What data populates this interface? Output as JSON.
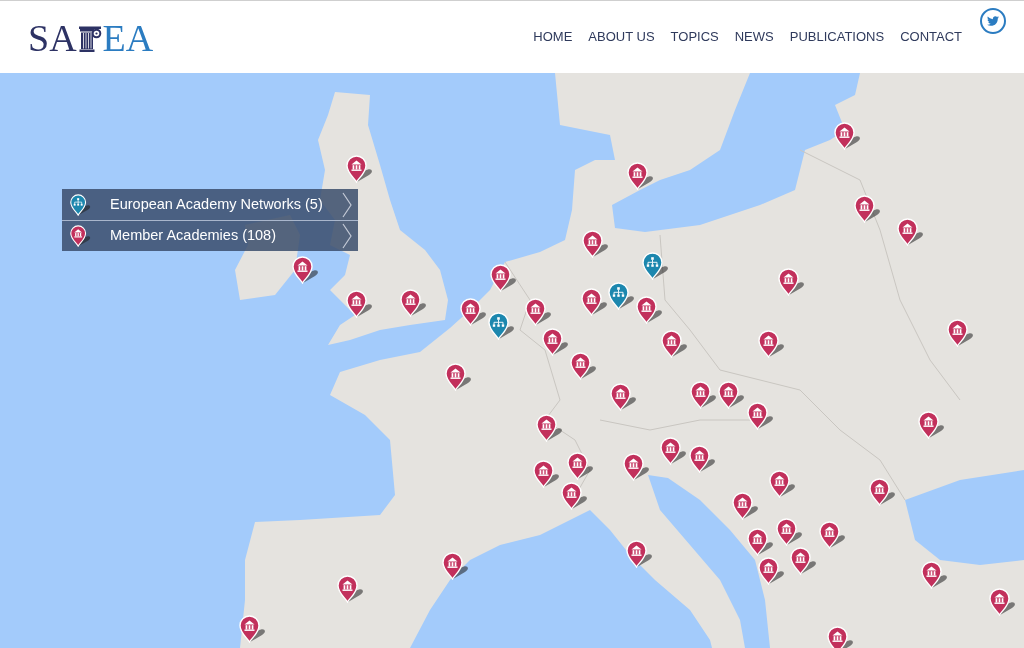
{
  "header": {
    "logo": {
      "text_before": "SA",
      "text_after": "EA"
    },
    "nav": [
      "HOME",
      "ABOUT US",
      "TOPICS",
      "NEWS",
      "PUBLICATIONS",
      "CONTACT"
    ]
  },
  "map": {
    "legend": [
      {
        "kind": "network",
        "label": "European Academy Networks (5)"
      },
      {
        "kind": "academy",
        "label": "Member Academies (108)"
      }
    ],
    "markers": [
      {
        "kind": "academy"
      },
      {
        "kind": "academy"
      },
      {
        "kind": "academy"
      },
      {
        "kind": "academy"
      },
      {
        "kind": "academy"
      },
      {
        "kind": "academy"
      },
      {
        "kind": "academy"
      },
      {
        "kind": "network"
      },
      {
        "kind": "academy"
      },
      {
        "kind": "academy"
      },
      {
        "kind": "academy"
      },
      {
        "kind": "academy"
      },
      {
        "kind": "network"
      },
      {
        "kind": "academy"
      },
      {
        "kind": "network"
      },
      {
        "kind": "academy"
      },
      {
        "kind": "academy"
      },
      {
        "kind": "academy"
      },
      {
        "kind": "academy"
      },
      {
        "kind": "academy"
      },
      {
        "kind": "academy"
      },
      {
        "kind": "academy"
      },
      {
        "kind": "academy"
      },
      {
        "kind": "academy"
      },
      {
        "kind": "academy"
      },
      {
        "kind": "academy"
      },
      {
        "kind": "academy"
      },
      {
        "kind": "academy"
      },
      {
        "kind": "academy"
      },
      {
        "kind": "academy"
      },
      {
        "kind": "academy"
      },
      {
        "kind": "academy"
      },
      {
        "kind": "academy"
      },
      {
        "kind": "academy"
      },
      {
        "kind": "academy"
      },
      {
        "kind": "academy"
      },
      {
        "kind": "academy"
      },
      {
        "kind": "academy"
      },
      {
        "kind": "academy"
      },
      {
        "kind": "academy"
      },
      {
        "kind": "academy"
      },
      {
        "kind": "academy"
      },
      {
        "kind": "academy"
      },
      {
        "kind": "academy"
      },
      {
        "kind": "academy"
      },
      {
        "kind": "academy"
      },
      {
        "kind": "academy"
      },
      {
        "kind": "academy"
      },
      {
        "kind": "academy"
      },
      {
        "kind": "academy"
      },
      {
        "kind": "academy"
      }
    ]
  }
}
